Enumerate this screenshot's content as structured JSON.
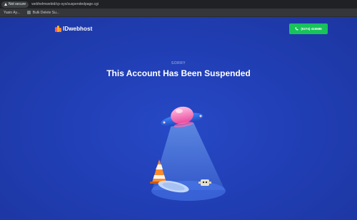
{
  "browser": {
    "security_label": "Not secure",
    "url": "webhelmwebid/cp-sys/suspendedpage.cgi"
  },
  "bookmarks": [
    {
      "label": "Yasin Ay..."
    },
    {
      "label": "Bulk Delete Su..."
    }
  ],
  "header": {
    "logo_text": "IDwebhost",
    "phone_label": "(0274) 415585"
  },
  "main": {
    "eyebrow": "SORRY",
    "title": "This Account Has Been Suspended"
  },
  "icons": {
    "security": "warning-triangle-icon",
    "bookmark": "bookmark-favicon-icon",
    "phone": "phone-icon"
  },
  "colors": {
    "background": "#1f3ca8",
    "button": "#19c25b",
    "browser_bar": "#202124"
  }
}
